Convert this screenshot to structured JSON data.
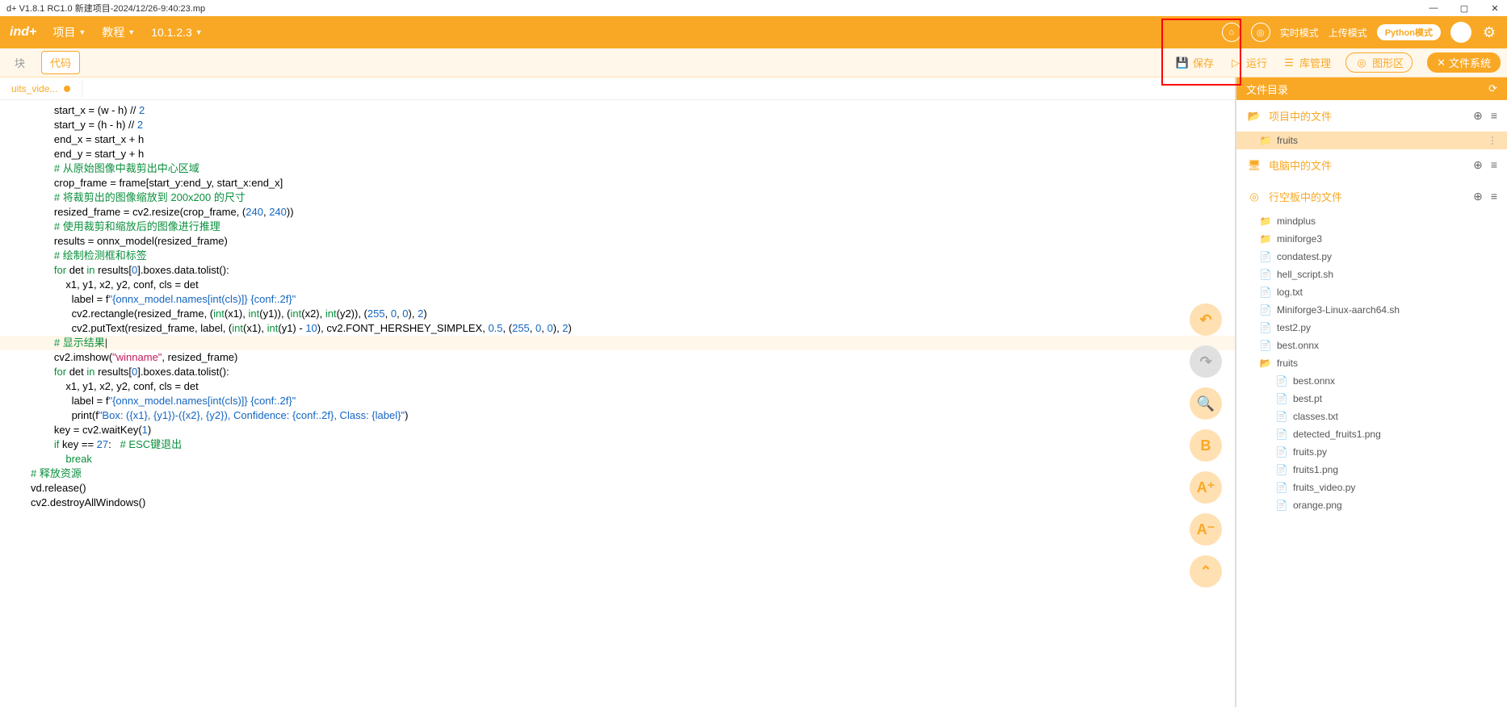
{
  "title": "d+ V1.8.1 RC1.0   新建项目-2024/12/26-9:40:23.mp",
  "menubar": {
    "logo": "ind+",
    "project": "项目",
    "tutorial": "教程",
    "ip": "10.1.2.3",
    "mode_realtime": "实时模式",
    "mode_upload": "上传模式",
    "python_badge": "Python模式"
  },
  "toolbar": {
    "tab_blocks": "块",
    "tab_code": "代码",
    "save": "保存",
    "run": "运行",
    "library": "库管理",
    "blocks_area": "图形区",
    "filesystem": "文件系统"
  },
  "file_tab": "uits_vide...",
  "code_lines": [
    {
      "indent": 3,
      "parts": [
        {
          "t": "start_x = (w - h) // ",
          "c": ""
        },
        {
          "t": "2",
          "c": "c-number"
        }
      ]
    },
    {
      "indent": 3,
      "parts": [
        {
          "t": "start_y = (h - h) // ",
          "c": ""
        },
        {
          "t": "2",
          "c": "c-number"
        }
      ]
    },
    {
      "indent": 3,
      "parts": [
        {
          "t": "end_x = start_x + h",
          "c": ""
        }
      ]
    },
    {
      "indent": 3,
      "parts": [
        {
          "t": "end_y = start_y + h",
          "c": ""
        }
      ]
    },
    {
      "indent": 0,
      "parts": []
    },
    {
      "indent": 3,
      "parts": [
        {
          "t": "# 从原始图像中裁剪出中心区域",
          "c": "c-comment"
        }
      ]
    },
    {
      "indent": 3,
      "parts": [
        {
          "t": "crop_frame = frame[start_y:end_y, start_x:end_x]",
          "c": ""
        }
      ]
    },
    {
      "indent": 0,
      "parts": []
    },
    {
      "indent": 3,
      "parts": [
        {
          "t": "# 将裁剪出的图像缩放到 200x200 的尺寸",
          "c": "c-comment"
        }
      ]
    },
    {
      "indent": 3,
      "parts": [
        {
          "t": "resized_frame = cv2.resize(crop_frame, (",
          "c": ""
        },
        {
          "t": "240",
          "c": "c-number"
        },
        {
          "t": ", ",
          "c": ""
        },
        {
          "t": "240",
          "c": "c-number"
        },
        {
          "t": "))",
          "c": ""
        }
      ]
    },
    {
      "indent": 0,
      "parts": []
    },
    {
      "indent": 3,
      "parts": [
        {
          "t": "# 使用裁剪和缩放后的图像进行推理",
          "c": "c-comment"
        }
      ]
    },
    {
      "indent": 3,
      "parts": [
        {
          "t": "results = onnx_model(resized_frame)",
          "c": ""
        }
      ]
    },
    {
      "indent": 0,
      "parts": []
    },
    {
      "indent": 3,
      "parts": [
        {
          "t": "# 绘制检测框和标签",
          "c": "c-comment"
        }
      ]
    },
    {
      "indent": 3,
      "parts": [
        {
          "t": "for",
          "c": "c-keyword"
        },
        {
          "t": " det ",
          "c": ""
        },
        {
          "t": "in",
          "c": "c-keyword"
        },
        {
          "t": " results[",
          "c": ""
        },
        {
          "t": "0",
          "c": "c-number"
        },
        {
          "t": "].boxes.data.tolist():",
          "c": ""
        }
      ]
    },
    {
      "indent": 4,
      "parts": [
        {
          "t": "x1, y1, x2, y2, conf, cls = det",
          "c": ""
        }
      ]
    },
    {
      "indent": 4,
      "parts": [
        {
          "t": "  label = f",
          "c": ""
        },
        {
          "t": "\"{onnx_model.names[int(cls)]} {conf:.2f}\"",
          "c": "c-fstring"
        }
      ]
    },
    {
      "indent": 4,
      "parts": [
        {
          "t": "  cv2.rectangle(resized_frame, (",
          "c": ""
        },
        {
          "t": "int",
          "c": "c-keyword"
        },
        {
          "t": "(x1), ",
          "c": ""
        },
        {
          "t": "int",
          "c": "c-keyword"
        },
        {
          "t": "(y1)), (",
          "c": ""
        },
        {
          "t": "int",
          "c": "c-keyword"
        },
        {
          "t": "(x2), ",
          "c": ""
        },
        {
          "t": "int",
          "c": "c-keyword"
        },
        {
          "t": "(y2)), (",
          "c": ""
        },
        {
          "t": "255",
          "c": "c-number"
        },
        {
          "t": ", ",
          "c": ""
        },
        {
          "t": "0",
          "c": "c-number"
        },
        {
          "t": ", ",
          "c": ""
        },
        {
          "t": "0",
          "c": "c-number"
        },
        {
          "t": "), ",
          "c": ""
        },
        {
          "t": "2",
          "c": "c-number"
        },
        {
          "t": ")",
          "c": ""
        }
      ]
    },
    {
      "indent": 4,
      "parts": [
        {
          "t": "  cv2.putText(resized_frame, label, (",
          "c": ""
        },
        {
          "t": "int",
          "c": "c-keyword"
        },
        {
          "t": "(x1), ",
          "c": ""
        },
        {
          "t": "int",
          "c": "c-keyword"
        },
        {
          "t": "(y1) - ",
          "c": ""
        },
        {
          "t": "10",
          "c": "c-number"
        },
        {
          "t": "), cv2.FONT_HERSHEY_SIMPLEX, ",
          "c": ""
        },
        {
          "t": "0.5",
          "c": "c-number"
        },
        {
          "t": ", (",
          "c": ""
        },
        {
          "t": "255",
          "c": "c-number"
        },
        {
          "t": ", ",
          "c": ""
        },
        {
          "t": "0",
          "c": "c-number"
        },
        {
          "t": ", ",
          "c": ""
        },
        {
          "t": "0",
          "c": "c-number"
        },
        {
          "t": "), ",
          "c": ""
        },
        {
          "t": "2",
          "c": "c-number"
        },
        {
          "t": ")",
          "c": ""
        }
      ]
    },
    {
      "indent": 0,
      "parts": []
    },
    {
      "indent": 3,
      "cursor": true,
      "parts": [
        {
          "t": "# 显示结果",
          "c": "c-comment"
        }
      ]
    },
    {
      "indent": 3,
      "parts": [
        {
          "t": "cv2.imshow(",
          "c": ""
        },
        {
          "t": "\"winname\"",
          "c": "c-string"
        },
        {
          "t": ", resized_frame)",
          "c": ""
        }
      ]
    },
    {
      "indent": 0,
      "parts": []
    },
    {
      "indent": 3,
      "parts": [
        {
          "t": "for",
          "c": "c-keyword"
        },
        {
          "t": " det ",
          "c": ""
        },
        {
          "t": "in",
          "c": "c-keyword"
        },
        {
          "t": " results[",
          "c": ""
        },
        {
          "t": "0",
          "c": "c-number"
        },
        {
          "t": "].boxes.data.tolist():",
          "c": ""
        }
      ]
    },
    {
      "indent": 4,
      "parts": [
        {
          "t": "x1, y1, x2, y2, conf, cls = det",
          "c": ""
        }
      ]
    },
    {
      "indent": 4,
      "parts": [
        {
          "t": "  label = f",
          "c": ""
        },
        {
          "t": "\"{onnx_model.names[int(cls)]} {conf:.2f}\"",
          "c": "c-fstring"
        }
      ]
    },
    {
      "indent": 4,
      "parts": [
        {
          "t": "  print",
          "c": ""
        },
        {
          "t": "(f",
          "c": ""
        },
        {
          "t": "\"Box: ({x1}, {y1})-({x2}, {y2}), Confidence: {conf:.2f}, Class: {label}\"",
          "c": "c-fstring"
        },
        {
          "t": ")",
          "c": ""
        }
      ]
    },
    {
      "indent": 0,
      "parts": []
    },
    {
      "indent": 3,
      "parts": [
        {
          "t": "key = cv2.waitKey(",
          "c": ""
        },
        {
          "t": "1",
          "c": "c-number"
        },
        {
          "t": ")",
          "c": ""
        }
      ]
    },
    {
      "indent": 3,
      "parts": [
        {
          "t": "if",
          "c": "c-keyword"
        },
        {
          "t": " key == ",
          "c": ""
        },
        {
          "t": "27",
          "c": "c-number"
        },
        {
          "t": ":   ",
          "c": ""
        },
        {
          "t": "# ESC键退出",
          "c": "c-comment"
        }
      ]
    },
    {
      "indent": 4,
      "parts": [
        {
          "t": "break",
          "c": "c-keyword"
        }
      ]
    },
    {
      "indent": 0,
      "parts": []
    },
    {
      "indent": 1,
      "parts": [
        {
          "t": "# 释放资源",
          "c": "c-comment"
        }
      ]
    },
    {
      "indent": 1,
      "parts": [
        {
          "t": "vd.release()",
          "c": ""
        }
      ]
    },
    {
      "indent": 1,
      "parts": [
        {
          "t": "cv2.destroyAllWindows()",
          "c": ""
        }
      ]
    }
  ],
  "float_labels": [
    "↶",
    "↷",
    "🔍",
    "B",
    "A⁺",
    "A⁻",
    "⌃"
  ],
  "sidebar": {
    "header": "文件目录",
    "sections": {
      "project_files": "项目中的文件",
      "computer_files": "电脑中的文件",
      "board_files": "行空板中的文件"
    },
    "project_tree": [
      {
        "type": "folder",
        "name": "fruits",
        "selected": true
      }
    ],
    "board_tree": [
      {
        "type": "folder",
        "name": "mindplus",
        "depth": 1
      },
      {
        "type": "folder",
        "name": "miniforge3",
        "depth": 1
      },
      {
        "type": "file",
        "name": "condatest.py",
        "depth": 1
      },
      {
        "type": "file",
        "name": "hell_script.sh",
        "depth": 1
      },
      {
        "type": "file",
        "name": "log.txt",
        "depth": 1
      },
      {
        "type": "file",
        "name": "Miniforge3-Linux-aarch64.sh",
        "depth": 1
      },
      {
        "type": "file",
        "name": "test2.py",
        "depth": 1
      },
      {
        "type": "file",
        "name": "best.onnx",
        "depth": 1
      },
      {
        "type": "folder",
        "name": "fruits",
        "depth": 1,
        "open": true
      },
      {
        "type": "file",
        "name": "best.onnx",
        "depth": 2
      },
      {
        "type": "file",
        "name": "best.pt",
        "depth": 2
      },
      {
        "type": "file",
        "name": "classes.txt",
        "depth": 2
      },
      {
        "type": "file",
        "name": "detected_fruits1.png",
        "depth": 2
      },
      {
        "type": "file",
        "name": "fruits.py",
        "depth": 2
      },
      {
        "type": "file",
        "name": "fruits1.png",
        "depth": 2
      },
      {
        "type": "file",
        "name": "fruits_video.py",
        "depth": 2
      },
      {
        "type": "file",
        "name": "orange.png",
        "depth": 2
      }
    ]
  }
}
